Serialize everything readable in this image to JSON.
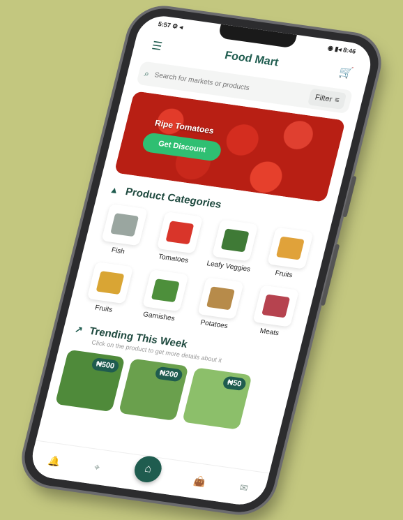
{
  "status": {
    "left": "5:57 ⚙ ◂",
    "right": "◉ ▮◂ 8:46"
  },
  "appbar": {
    "title": "Food Mart",
    "menu_icon": "menu-icon",
    "cart_icon": "cart-icon"
  },
  "search": {
    "placeholder": "Search for markets or products",
    "filter_label": "Filter"
  },
  "banner": {
    "promo_text": "Ripe Tomatoes",
    "cta_label": "Get Discount"
  },
  "categories": {
    "title": "Product Categories",
    "items": [
      {
        "label": "Fish",
        "color": "#9aa6a0"
      },
      {
        "label": "Tomatoes",
        "color": "#d9352a"
      },
      {
        "label": "Leafy Veggies",
        "color": "#3f7a36"
      },
      {
        "label": "Fruits",
        "color": "#e0a23a"
      },
      {
        "label": "Fruits",
        "color": "#d9a534"
      },
      {
        "label": "Garnishes",
        "color": "#4d8f3b"
      },
      {
        "label": "Potatoes",
        "color": "#b78b4a"
      },
      {
        "label": "Meats",
        "color": "#b6434f"
      }
    ]
  },
  "trending": {
    "title": "Trending This Week",
    "subtitle": "Click on the product to get more details about it",
    "items": [
      {
        "price": "₦500",
        "color": "#4f8a3a"
      },
      {
        "price": "₦200",
        "color": "#6aa04d"
      },
      {
        "price": "₦50",
        "color": "#8cbf6a"
      }
    ]
  },
  "nav": {
    "items": [
      "notification-icon",
      "location-icon",
      "home-icon",
      "bag-icon",
      "chat-icon"
    ]
  }
}
